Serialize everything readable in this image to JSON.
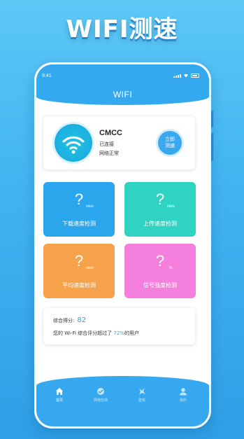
{
  "promo": {
    "title": "WIFI测速"
  },
  "status_bar": {
    "time": "9:41"
  },
  "header": {
    "title": "WIFI"
  },
  "wifi_card": {
    "ssid": "CMCC",
    "connection_status": "已连接",
    "network_status": "网络正常",
    "test_button": {
      "line1": "立即",
      "line2": "测速"
    }
  },
  "tiles": [
    {
      "value": "?",
      "unit": "mb/s",
      "label": "下载速度检测",
      "color": "#2aa6ec"
    },
    {
      "value": "?",
      "unit": "mb/s",
      "label": "上传速度检测",
      "color": "#2ed3c2"
    },
    {
      "value": "?",
      "unit": "mb/s",
      "label": "平均速度检测",
      "color": "#f6a24a"
    },
    {
      "value": "?",
      "unit": "%",
      "label": "信号强度检测",
      "color": "#f57fdc"
    }
  ],
  "score": {
    "label": "综合得分:",
    "value": "82",
    "desc_prefix": "您的 Wi-Fi 综合评分超过了",
    "percent": "72%",
    "desc_suffix": "的用户"
  },
  "tabbar": {
    "items": [
      {
        "label": "首页",
        "icon": "home-icon",
        "active": true
      },
      {
        "label": "网络检测",
        "icon": "network-check-icon",
        "active": false
      },
      {
        "label": "壁纸",
        "icon": "wallpaper-icon",
        "active": false
      },
      {
        "label": "我的",
        "icon": "profile-icon",
        "active": false
      }
    ]
  },
  "colors": {
    "accent": "#35a9ef",
    "score": "#2aa6ec"
  }
}
